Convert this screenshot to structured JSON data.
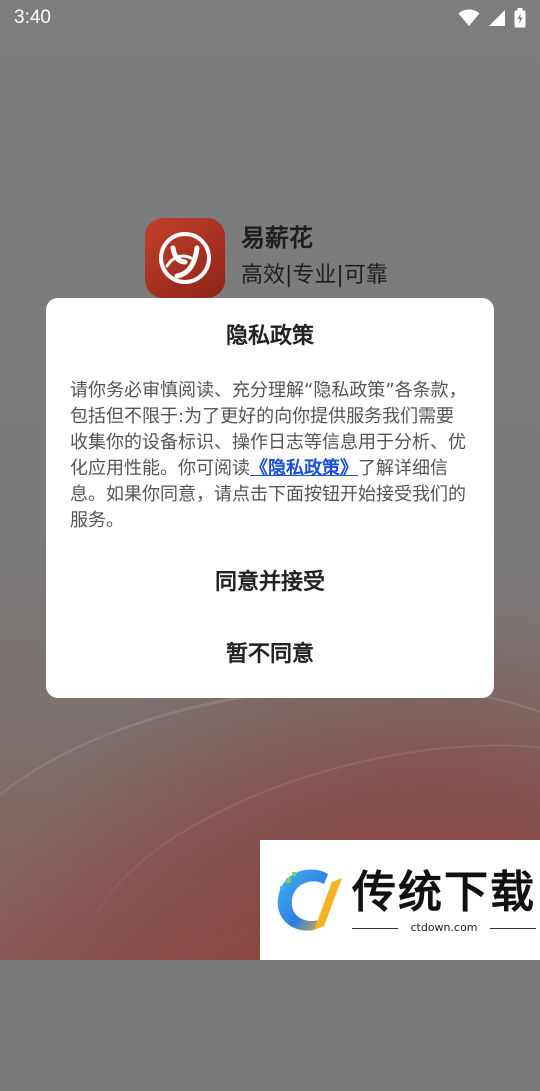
{
  "status_bar": {
    "time": "3:40",
    "icons": [
      "wifi-icon",
      "cellular-signal-icon",
      "battery-charging-icon"
    ]
  },
  "splash": {
    "app_name": "易薪花",
    "slogan": "高效|专业|可靠",
    "logo_letter": "y",
    "brand_color": "#b0321f"
  },
  "dialog": {
    "title": "隐私政策",
    "body_before_link": "请你务必审慎阅读、充分理解“隐私政策”各条款，包括但不限于:为了更好的向你提供服务我们需要收集你的设备标识、操作日志等信息用于分析、优化应用性能。你可阅读",
    "link_text": "《隐私政策》",
    "body_after_link": "了解详细信息。如果你同意，请点击下面按钮开始接受我们的服务。",
    "agree_button": "同意并接受",
    "disagree_button": "暂不同意",
    "link_color": "#1a4fd6"
  },
  "watermark": {
    "title": "传统下载",
    "url": "ctdown.com"
  }
}
